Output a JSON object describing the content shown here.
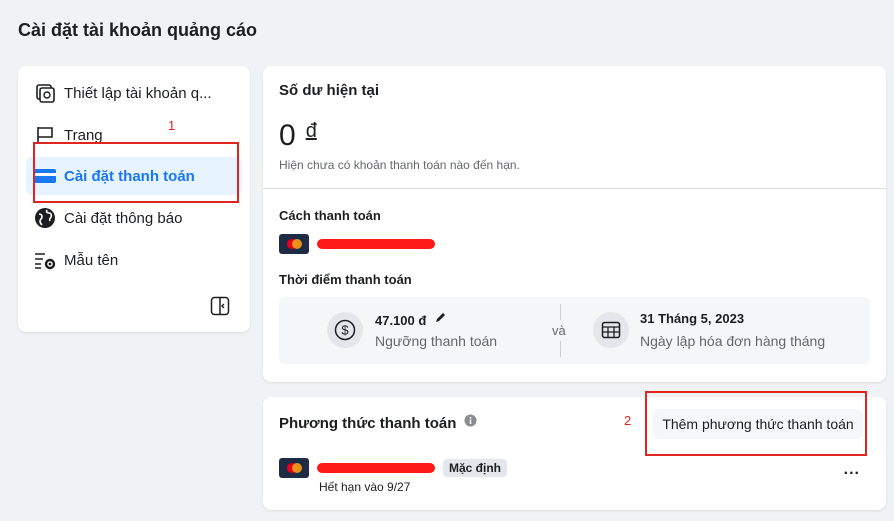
{
  "page_title": "Cài đặt tài khoản quảng cáo",
  "sidebar": {
    "items": [
      {
        "label": "Thiết lập tài khoản q...",
        "icon": "account-setup-icon",
        "active": false
      },
      {
        "label": "Trang",
        "icon": "flag-icon",
        "active": false
      },
      {
        "label": "Cài đặt thanh toán",
        "icon": "credit-card-icon",
        "active": true
      },
      {
        "label": "Cài đặt thông báo",
        "icon": "globe-icon",
        "active": false
      },
      {
        "label": "Mẫu tên",
        "icon": "list-gear-icon",
        "active": false
      }
    ],
    "collapse_icon": "collapse-sidebar-icon"
  },
  "balance": {
    "title": "Số dư hiện tại",
    "amount": "0",
    "currency": "đ",
    "note": "Hiện chưa có khoản thanh toán nào đến hạn."
  },
  "payment_method_section": {
    "title": "Cách thanh toán"
  },
  "timing": {
    "title": "Thời điểm thanh toán",
    "threshold_value": "47.100 đ",
    "threshold_label": "Ngưỡng thanh toán",
    "and_label": "và",
    "date_value": "31 Tháng 5, 2023",
    "date_label": "Ngày lập hóa đơn hàng tháng"
  },
  "methods_card": {
    "title": "Phương thức thanh toán",
    "add_button": "Thêm phương thức thanh toán",
    "default_badge": "Mặc định",
    "expiry": "Hết hạn vào 9/27",
    "more_label": "..."
  },
  "annotations": {
    "one": "1",
    "two": "2",
    "color": "#e0241f"
  },
  "colors": {
    "accent": "#1877f2",
    "active_bg": "#e7f3ff",
    "background": "#f0f2f5"
  }
}
